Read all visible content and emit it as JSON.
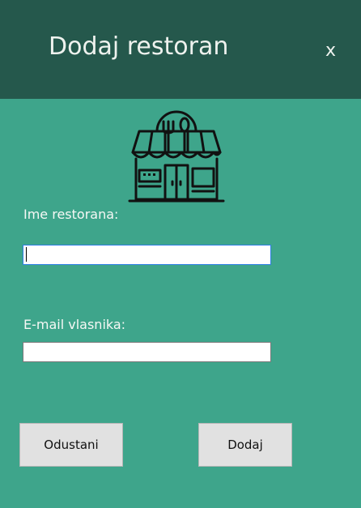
{
  "window": {
    "title": "Dodaj restoran",
    "close_label": "x"
  },
  "form": {
    "restaurant_name": {
      "label": "Ime restorana:",
      "value": ""
    },
    "owner_email": {
      "label": "E-mail vlasnika:",
      "value": ""
    }
  },
  "buttons": {
    "cancel_label": "Odustani",
    "add_label": "Dodaj"
  },
  "icons": {
    "logo": "restaurant-storefront-icon"
  },
  "colors": {
    "background": "#3ea58b",
    "titlebar": "#25584c",
    "button": "#e1e1e1",
    "focus_border": "#2d7fe6"
  }
}
